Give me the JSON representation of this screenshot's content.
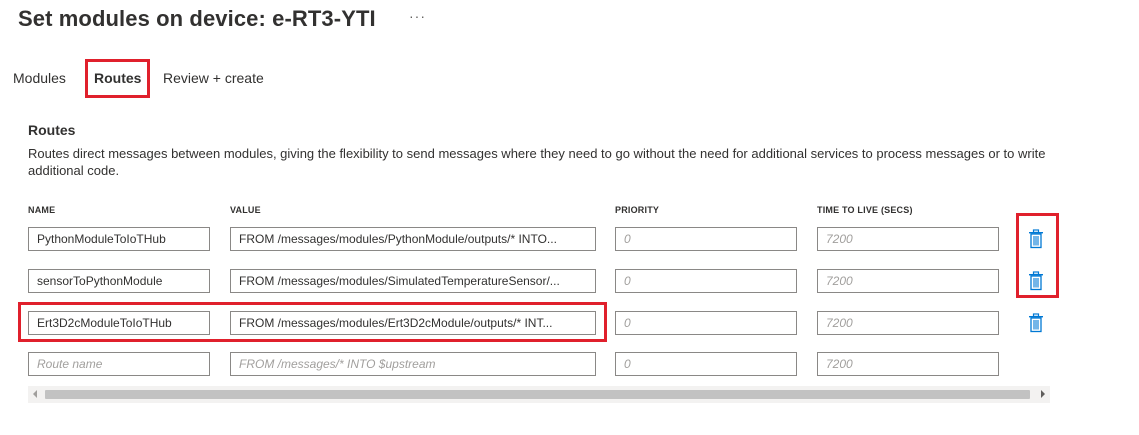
{
  "page": {
    "title": "Set modules on device: e-RT3-YTI",
    "more_label": "···"
  },
  "tabs": [
    {
      "label": "Modules",
      "active": false
    },
    {
      "label": "Routes",
      "active": true
    },
    {
      "label": "Review + create",
      "active": false
    }
  ],
  "routes_section": {
    "title": "Routes",
    "description": "Routes direct messages between modules, giving the flexibility to send messages where they need to go without the need for additional services to process messages or to write additional code."
  },
  "columns": {
    "name": "NAME",
    "value": "VALUE",
    "priority": "PRIORITY",
    "ttl": "TIME TO LIVE (SECS)"
  },
  "routes": [
    {
      "name": "PythonModuleToIoTHub",
      "value": "FROM /messages/modules/PythonModule/outputs/* INTO...",
      "priority_placeholder": "0",
      "ttl_placeholder": "7200"
    },
    {
      "name": "sensorToPythonModule",
      "value": "FROM /messages/modules/SimulatedTemperatureSensor/...",
      "priority_placeholder": "0",
      "ttl_placeholder": "7200"
    },
    {
      "name": "Ert3D2cModuleToIoTHub",
      "value": "FROM /messages/modules/Ert3D2cModule/outputs/* INT...",
      "priority_placeholder": "0",
      "ttl_placeholder": "7200"
    }
  ],
  "new_route": {
    "name_placeholder": "Route name",
    "value_placeholder": "FROM /messages/* INTO $upstream",
    "priority_placeholder": "0",
    "ttl_placeholder": "7200"
  },
  "colors": {
    "highlight": "#e0202c",
    "trash_icon": "#0078d4"
  },
  "icons": {
    "delete": "trash-icon",
    "more": "more-icon"
  }
}
